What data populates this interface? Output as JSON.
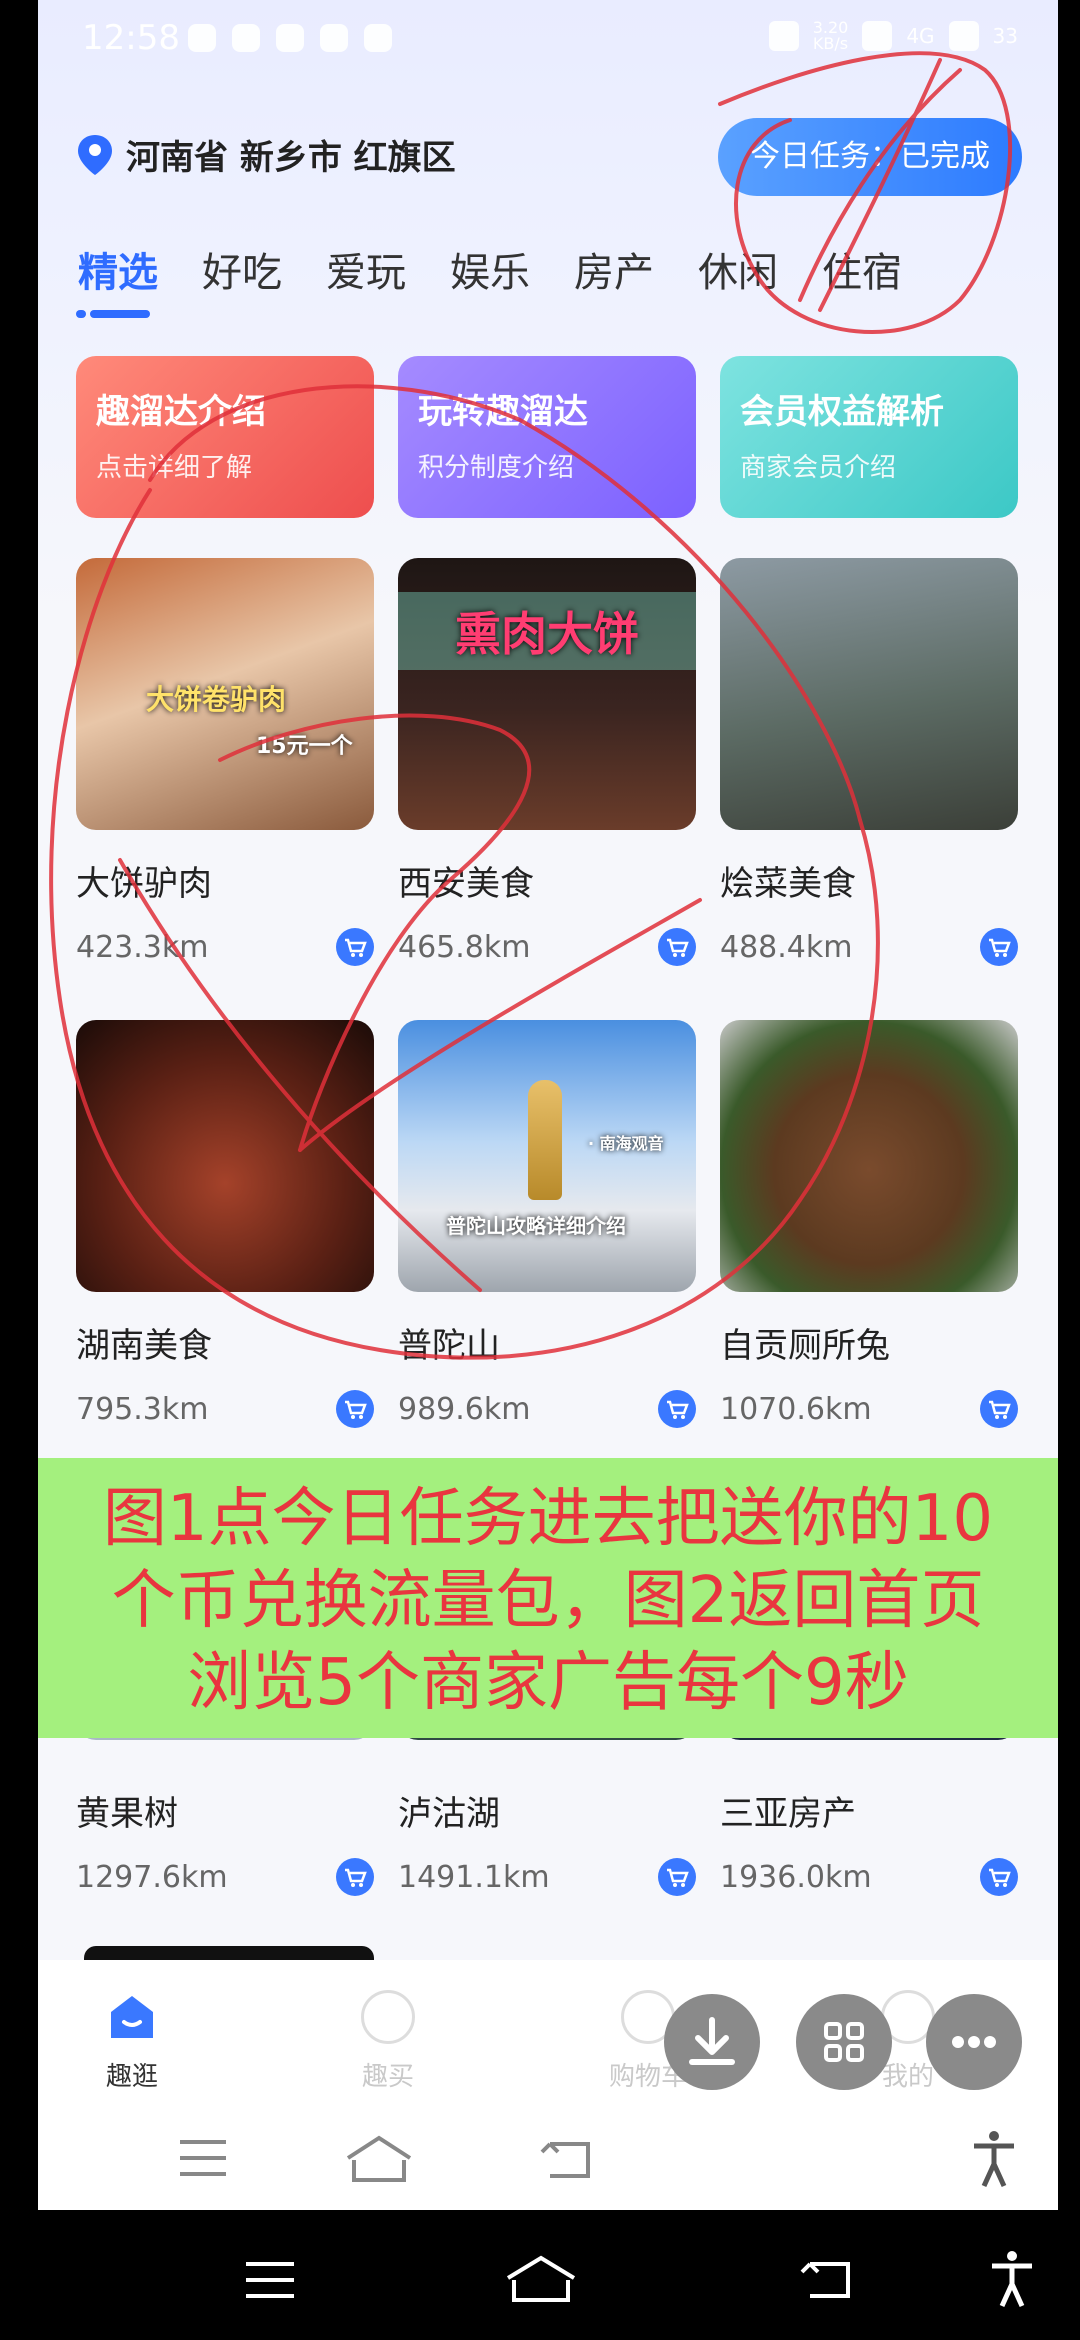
{
  "status_bar": {
    "time": "12:58",
    "speed": "3.20\nKB/s",
    "network": "4G",
    "battery": "33"
  },
  "location": {
    "text": "河南省 新乡市 红旗区"
  },
  "task_button": {
    "label": "今日任务：已完成"
  },
  "tabs": [
    {
      "label": "精选",
      "active": true
    },
    {
      "label": "好吃"
    },
    {
      "label": "爱玩"
    },
    {
      "label": "娱乐"
    },
    {
      "label": "房产"
    },
    {
      "label": "休闲"
    },
    {
      "label": "住宿"
    }
  ],
  "features": [
    {
      "title": "趣溜达介绍",
      "subtitle": "点击详细了解"
    },
    {
      "title": "玩转趣溜达",
      "subtitle": "积分制度介绍"
    },
    {
      "title": "会员权益解析",
      "subtitle": "商家会员介绍"
    }
  ],
  "items": [
    {
      "name": "大饼驴肉",
      "distance": "423.3km",
      "overlay_a": "大饼卷驴肉",
      "overlay_b": "15元一个"
    },
    {
      "name": "西安美食",
      "distance": "465.8km",
      "overlay_a": "熏肉大饼"
    },
    {
      "name": "烩菜美食",
      "distance": "488.4km"
    },
    {
      "name": "湖南美食",
      "distance": "795.3km"
    },
    {
      "name": "普陀山",
      "distance": "989.6km",
      "overlay_a": "· 南海观音",
      "overlay_b": "普陀山攻略详细介绍"
    },
    {
      "name": "自贡厕所兔",
      "distance": "1070.6km"
    },
    {
      "name": "黄果树",
      "distance": "1297.6km"
    },
    {
      "name": "泸沽湖",
      "distance": "1491.1km"
    },
    {
      "name": "三亚房产",
      "distance": "1936.0km"
    }
  ],
  "annotation": {
    "line1": "图1点今日任务进去把送你的10",
    "line2": "个币兑换流量包，图2返回首页",
    "line3": "浏览5个商家广告每个9秒"
  },
  "bottom_nav": [
    {
      "label": "趣逛",
      "active": true
    },
    {
      "label": "趣买"
    },
    {
      "label": "购物车"
    },
    {
      "label": "我的"
    }
  ],
  "colors": {
    "accent": "#2f6cff",
    "annotation_bg": "#a4f07e",
    "annotation_text": "#e9353f",
    "scribble": "#e0303a"
  }
}
